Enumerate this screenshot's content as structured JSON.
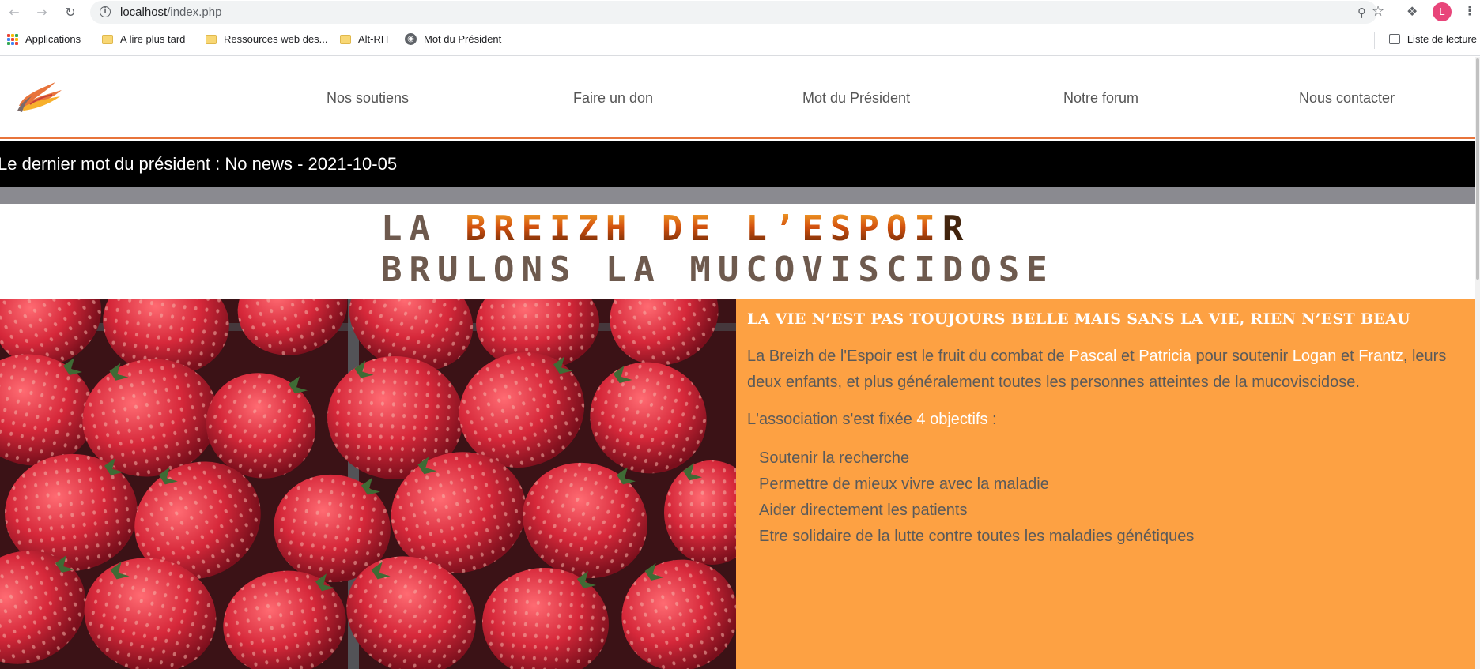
{
  "browser": {
    "url_host": "localhost",
    "url_path": "/index.php",
    "profile_initial": "L",
    "bookmarks": [
      {
        "label": "Applications",
        "icon": "apps-grid-icon"
      },
      {
        "label": "A lire plus tard",
        "icon": "folder-icon"
      },
      {
        "label": "Ressources web des...",
        "icon": "folder-icon"
      },
      {
        "label": "Alt-RH",
        "icon": "folder-icon"
      },
      {
        "label": "Mot du Président",
        "icon": "globe-icon"
      }
    ],
    "reading_list_label": "Liste de lecture"
  },
  "site": {
    "nav": [
      {
        "label": "Nos soutiens"
      },
      {
        "label": "Faire un don"
      },
      {
        "label": "Mot du Président"
      },
      {
        "label": "Notre forum"
      },
      {
        "label": "Nous contacter"
      }
    ],
    "ticker_text": "Le dernier mot du président : No news - 2021-10-05",
    "hero": {
      "line1_a": "LA ",
      "line1_b": "BREIZH DE L’ESPOI",
      "line1_c": "R",
      "line2": "BRULONS LA MUCOVISCIDOSE"
    },
    "panel": {
      "heading": "LA VIE N’EST PAS TOUJOURS BELLE MAIS SANS LA VIE, RIEN N’EST BEAU",
      "intro_1": "La Breizh de l'Espoir est le fruit du combat de ",
      "name_1": "Pascal",
      "and_1": " et ",
      "name_2": "Patricia",
      "intro_2": " pour soutenir ",
      "name_3": "Logan",
      "and_2": " et ",
      "name_4": "Frantz",
      "intro_3": ", leurs deux enfants, et plus généralement toutes les personnes atteintes de la mucoviscidose.",
      "obj_1": "L'association s'est fixée ",
      "obj_hl": "4 objectifs",
      "obj_2": " :",
      "objectives": [
        "Soutenir la recherche",
        "Permettre de mieux vivre avec la maladie",
        "Aider directement les patients",
        "Etre solidaire de la lutte contre toutes les maladies génétiques"
      ]
    },
    "colors": {
      "accent_orange": "#fda143",
      "header_border": "#e8743b",
      "title_brown": "#6e5a4e"
    }
  }
}
